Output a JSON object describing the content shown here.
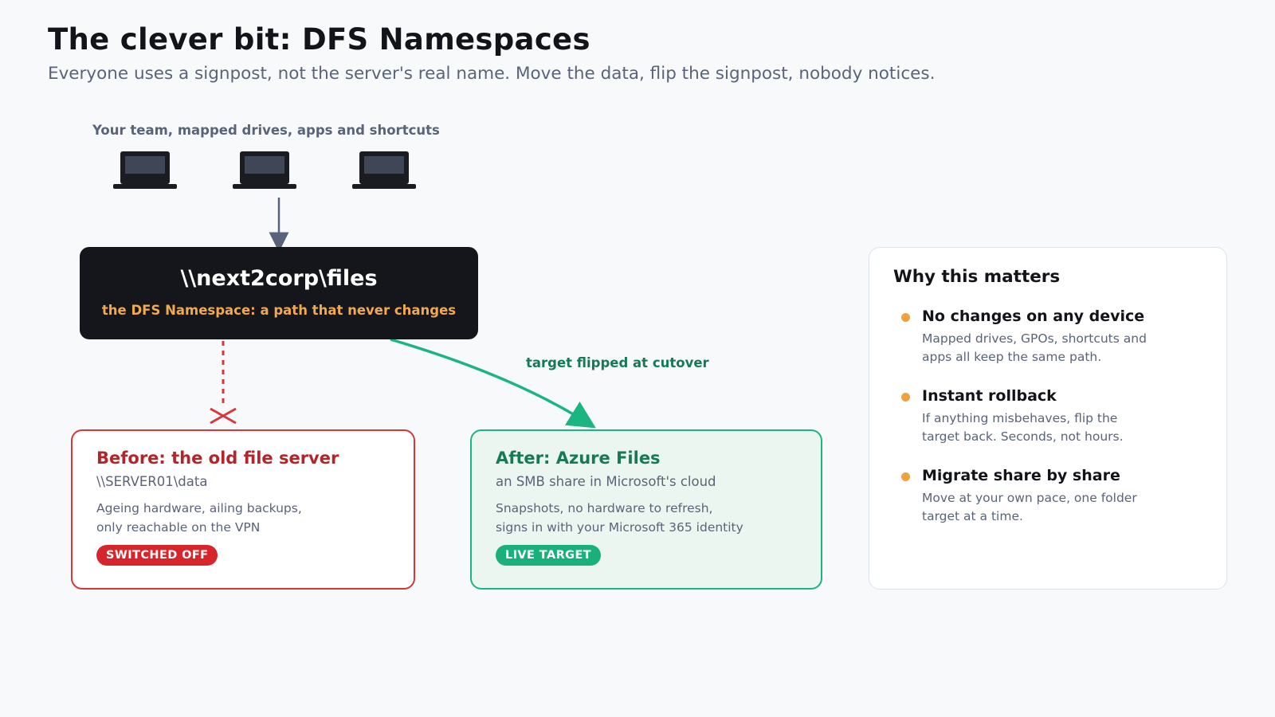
{
  "header": {
    "title": "The clever bit: DFS Namespaces",
    "subtitle": "Everyone uses a signpost, not the server's real name. Move the data, flip the signpost, nobody notices."
  },
  "clients": {
    "label": "Your team, mapped drives, apps and shortcuts",
    "devices": [
      "laptop-icon",
      "laptop-icon",
      "laptop-icon"
    ]
  },
  "namespace": {
    "path": "\\\\next2corp\\files",
    "caption": "the DFS Namespace: a path that never changes"
  },
  "cutover": {
    "label": "target flipped at cutover"
  },
  "old_server": {
    "title": "Before: the old file server",
    "path": "\\\\SERVER01\\data",
    "description_lines": [
      "Ageing hardware, ailing backups,",
      "only reachable on the VPN"
    ],
    "badge": "SWITCHED OFF"
  },
  "new_target": {
    "title": "After: Azure Files",
    "path": "an SMB share in Microsoft's cloud",
    "description_lines": [
      "Snapshots, no hardware to refresh,",
      "signs in with your Microsoft 365 identity"
    ],
    "badge": "LIVE TARGET"
  },
  "why": {
    "title": "Why this matters",
    "items": [
      {
        "heading": "No changes on any device",
        "lines": [
          "Mapped drives, GPOs, shortcuts and",
          "apps all keep the same path."
        ]
      },
      {
        "heading": "Instant rollback",
        "lines": [
          "If anything misbehaves, flip the",
          "target back. Seconds, not hours."
        ]
      },
      {
        "heading": "Migrate share by share",
        "lines": [
          "Move at your own pace, one folder",
          "target at a time."
        ]
      }
    ]
  },
  "colors": {
    "old": "#d8363a",
    "new": "#1bb582",
    "accent": "#f2a03a",
    "namespace_bg": "#15161b"
  }
}
